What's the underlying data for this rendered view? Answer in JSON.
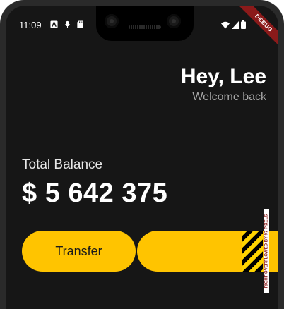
{
  "status_bar": {
    "time": "11:09",
    "left_icons": [
      "a-letter-icon",
      "mic-icon",
      "sd-card-icon"
    ],
    "right_icons": [
      "wifi-icon",
      "cell-signal-icon",
      "battery-icon"
    ]
  },
  "debug_banner": "DEBUG",
  "greeting": {
    "title": "Hey, Lee",
    "subtitle": "Welcome back"
  },
  "balance": {
    "label": "Total Balance",
    "value": "$ 5 642 375"
  },
  "actions": {
    "transfer_label": "Transfer",
    "second_label": ""
  },
  "overflow_warning": "RIGHT OVERFLOWED BY 97 PIXELS",
  "colors": {
    "background": "#161616",
    "accent": "#ffc400",
    "text_primary": "#ffffff",
    "text_secondary": "#a7a7a7",
    "debug_banner": "#8b1a1a"
  }
}
